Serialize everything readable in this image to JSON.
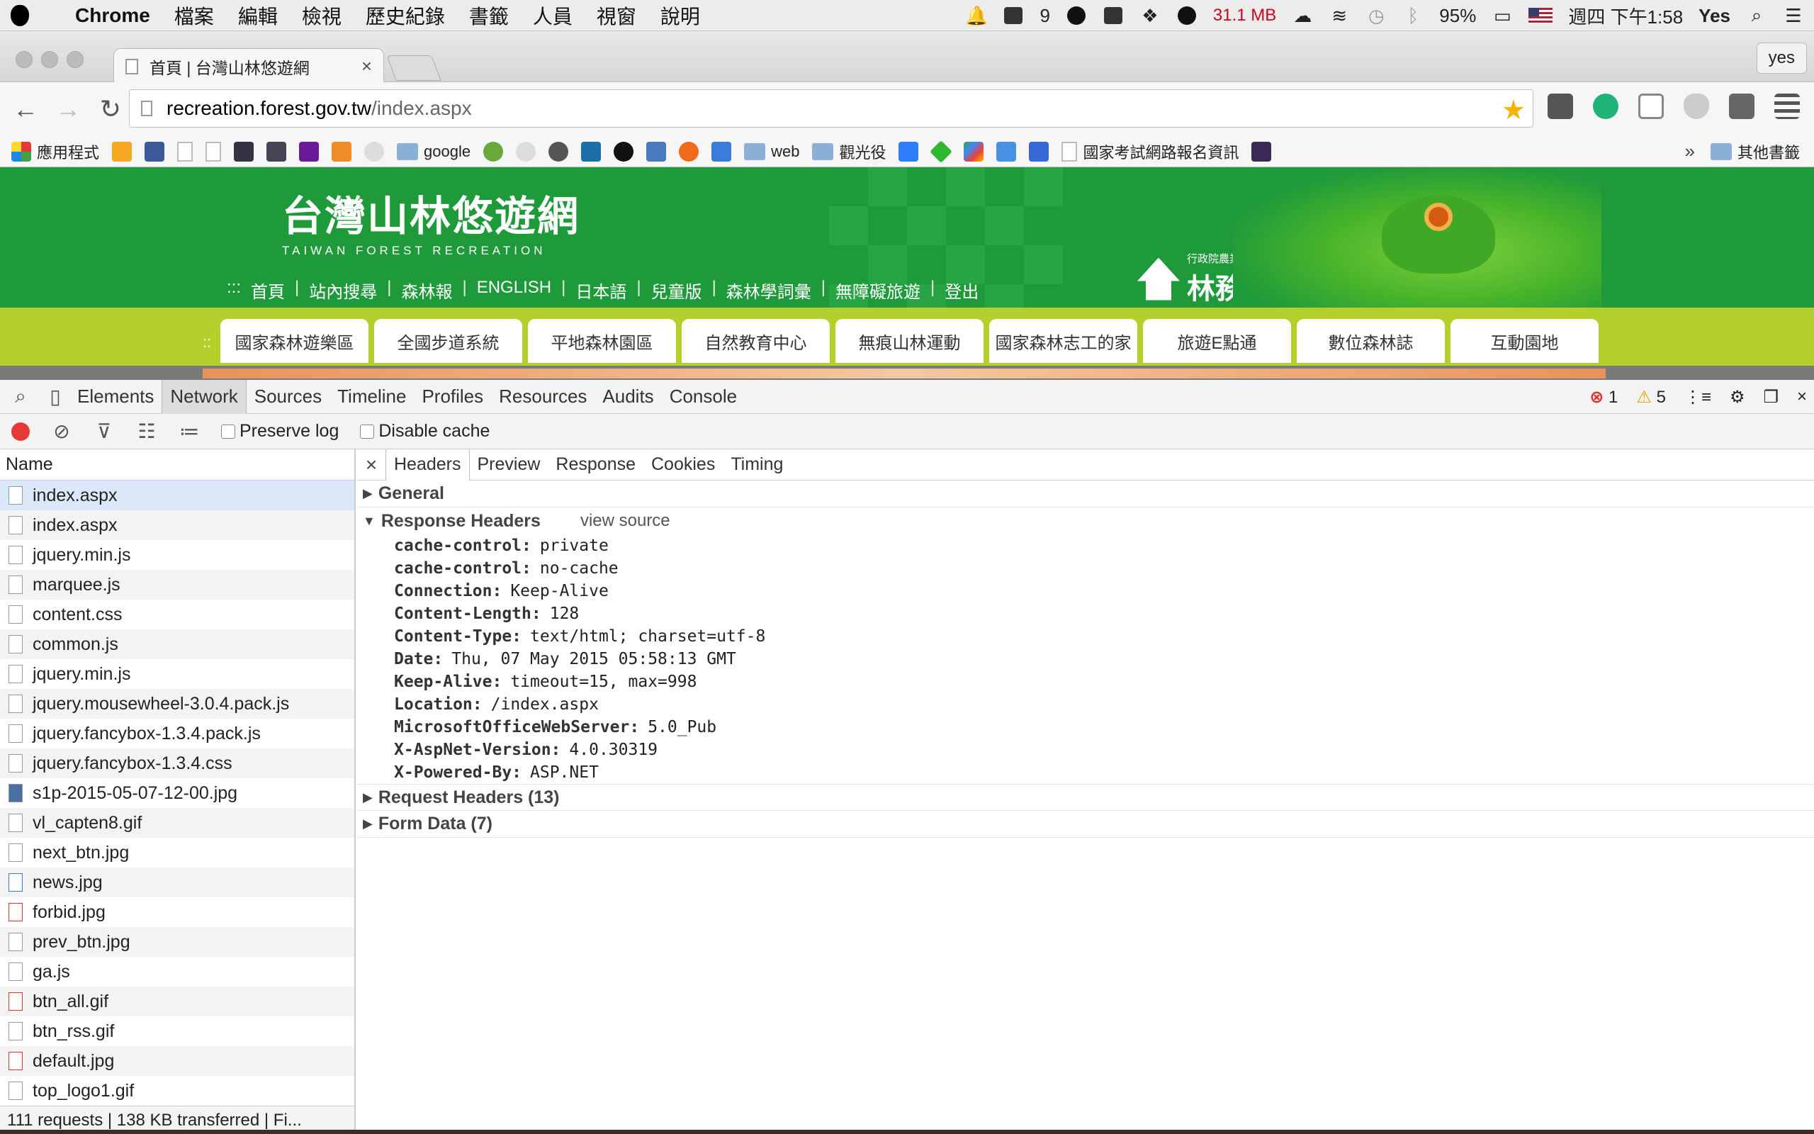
{
  "menubar": {
    "app_name": "Chrome",
    "items": [
      "檔案",
      "編輯",
      "檢視",
      "歷史紀錄",
      "書籤",
      "人員",
      "視窗",
      "說明"
    ],
    "notification_count": "9",
    "memory": "31.1 MB",
    "battery": "95%",
    "clock": "週四 下午1:58",
    "user": "Yes"
  },
  "browser": {
    "tab_title": "首頁 | 台灣山林悠遊網",
    "profile": "yes",
    "url_host": "recreation.forest.gov.tw",
    "url_path": "/index.aspx"
  },
  "bookmarks": {
    "apps": "應用程式",
    "google": "google",
    "web": "web",
    "guanguang": "觀光役",
    "exam": "國家考試網路報名資訊",
    "overflow": "»",
    "other": "其他書籤"
  },
  "site": {
    "logo_cn": "台灣山林悠遊網",
    "logo_en": "TAIWAN   FOREST   RECREATION",
    "nav_prefix": ":::",
    "nav": [
      "首頁",
      "站內搜尋",
      "森林報",
      "ENGLISH",
      "日本語",
      "兒童版",
      "森林學詞彙",
      "無障礙旅遊",
      "登出"
    ],
    "org_small": "行政院農業委員會",
    "org_big": "林務局",
    "menu_prefix": "::",
    "menu": [
      "國家森林遊樂區",
      "全國步道系統",
      "平地森林園區",
      "自然教育中心",
      "無痕山林運動",
      "國家森林志工的家",
      "旅遊E點通",
      "數位森林誌",
      "互動園地"
    ]
  },
  "devtools": {
    "tabs": [
      "Elements",
      "Network",
      "Sources",
      "Timeline",
      "Profiles",
      "Resources",
      "Audits",
      "Console"
    ],
    "active_tab": "Network",
    "error_count": "1",
    "warning_count": "5",
    "preserve_log": "Preserve log",
    "disable_cache": "Disable cache",
    "list_header": "Name",
    "requests": [
      "index.aspx",
      "index.aspx",
      "jquery.min.js",
      "marquee.js",
      "content.css",
      "common.js",
      "jquery.min.js",
      "jquery.mousewheel-3.0.4.pack.js",
      "jquery.fancybox-1.3.4.pack.js",
      "jquery.fancybox-1.3.4.css",
      "s1p-2015-05-07-12-00.jpg",
      "vl_capten8.gif",
      "next_btn.jpg",
      "news.jpg",
      "forbid.jpg",
      "prev_btn.jpg",
      "ga.js",
      "btn_all.gif",
      "btn_rss.gif",
      "default.jpg",
      "top_logo1.gif"
    ],
    "status": "111 requests  |  138 KB transferred  |  Fi...",
    "detail_close": "×",
    "detail_tabs": [
      "Headers",
      "Preview",
      "Response",
      "Cookies",
      "Timing"
    ],
    "sections": {
      "general": "General",
      "response": "Response Headers",
      "view_source": "view source",
      "request": "Request Headers (13)",
      "form": "Form Data (7)"
    },
    "response_headers": [
      {
        "k": "cache-control:",
        "v": "private"
      },
      {
        "k": "cache-control:",
        "v": "no-cache"
      },
      {
        "k": "Connection:",
        "v": "Keep-Alive"
      },
      {
        "k": "Content-Length:",
        "v": "128"
      },
      {
        "k": "Content-Type:",
        "v": "text/html; charset=utf-8"
      },
      {
        "k": "Date:",
        "v": "Thu, 07 May 2015 05:58:13 GMT"
      },
      {
        "k": "Keep-Alive:",
        "v": "timeout=15, max=998"
      },
      {
        "k": "Location:",
        "v": "/index.aspx"
      },
      {
        "k": "MicrosoftOfficeWebServer:",
        "v": "5.0_Pub"
      },
      {
        "k": "X-AspNet-Version:",
        "v": "4.0.30319"
      },
      {
        "k": "X-Powered-By:",
        "v": "ASP.NET"
      }
    ]
  }
}
